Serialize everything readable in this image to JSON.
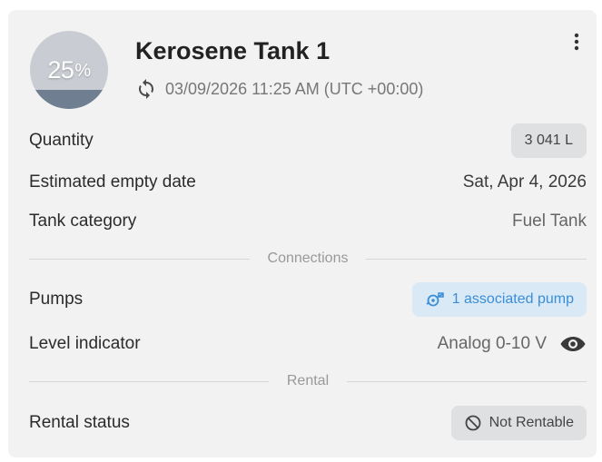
{
  "tank": {
    "level_number": "25",
    "level_unit": "%",
    "level_fraction": 0.25,
    "title": "Kerosene Tank 1",
    "last_sync": "03/09/2026 11:25 AM (UTC +00:00)"
  },
  "rows": {
    "quantity_label": "Quantity",
    "quantity_value": "3 041 L",
    "empty_date_label": "Estimated empty date",
    "empty_date_value": "Sat, Apr 4, 2026",
    "category_label": "Tank category",
    "category_value": "Fuel Tank"
  },
  "sections": {
    "connections": "Connections",
    "rental": "Rental"
  },
  "connections": {
    "pumps_label": "Pumps",
    "pumps_value": "1 associated pump",
    "level_indicator_label": "Level indicator",
    "level_indicator_value": "Analog 0-10 V"
  },
  "rental": {
    "status_label": "Rental status",
    "status_value": "Not Rentable"
  },
  "colors": {
    "gauge_empty": "#c9ccd2",
    "gauge_fill": "#6f7f91",
    "pump_chip_bg": "#d9e9f6",
    "pump_chip_text": "#3a8ed8"
  },
  "icons": {
    "sync": "sync-icon",
    "menu": "kebab-menu-icon",
    "pump": "pump-icon",
    "eye": "eye-icon",
    "not_allowed": "prohibited-icon"
  }
}
